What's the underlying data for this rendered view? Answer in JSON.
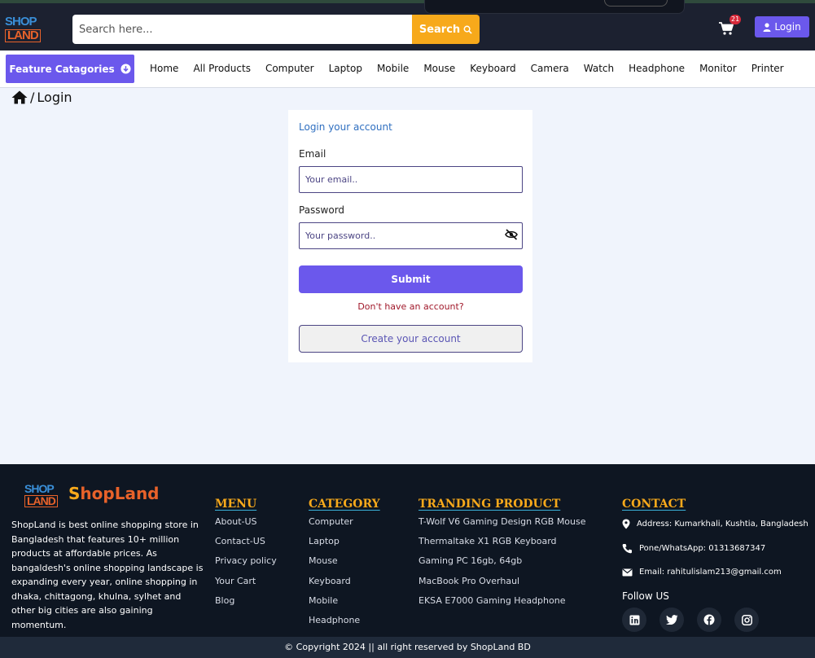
{
  "header": {
    "logo_top": "SHOP",
    "logo_bottom": "LAND",
    "search": {
      "placeholder": "Search here...",
      "button_label": "Search"
    },
    "cart_count": "21",
    "login_label": "Login"
  },
  "nav": {
    "feature_label": "Feature Catagories",
    "links": [
      "Home",
      "All Products",
      "Computer",
      "Laptop",
      "Mobile",
      "Mouse",
      "Keyboard",
      "Camera",
      "Watch",
      "Headphone",
      "Monitor",
      "Printer"
    ]
  },
  "breadcrumb": {
    "current": "Login"
  },
  "login": {
    "title": "Login your account",
    "email_label": "Email",
    "email_placeholder": "Your email..",
    "password_label": "Password",
    "password_placeholder": "Your password..",
    "submit_label": "Submit",
    "no_account_text": "Don't have an account?",
    "create_label": "Create your account"
  },
  "footer": {
    "brand_prefix": "S",
    "brand_rest": "hopLand",
    "description": "ShopLand is best online shopping store in Bangladesh that features 10+ million products at affordable prices. As bangaldesh's online shopping landscape is expanding every year, online shopping in dhaka, chittagong, khulna, sylhet and other big cities are also gaining momentum.",
    "menu": {
      "heading": "MENU",
      "items": [
        "About-US",
        "Contact-US",
        "Privacy policy",
        "Your Cart",
        "Blog"
      ]
    },
    "category": {
      "heading": "CATEGORY",
      "items": [
        "Computer",
        "Laptop",
        "Mouse",
        "Keyboard",
        "Mobile",
        "Headphone"
      ]
    },
    "trending": {
      "heading": "TRANDING PRODUCT",
      "items": [
        "T-Wolf V6 Gaming Design RGB Mouse",
        "Thermaltake X1 RGB Keyboard",
        "Gaming PC 16gb, 64gb",
        "MacBook Pro Overhaul",
        "EKSA E7000 Gaming Headphone"
      ]
    },
    "contact": {
      "heading": "CONTACT",
      "address": "Address: Kumarkhali, Kushtia, Bangladesh",
      "phone": "Pone/WhatsApp: 01313687347",
      "email": "Email: rahitulislam213@gmail.com",
      "follow": "Follow US"
    },
    "copyright": "© Copyright 2024 || all right reserved by ShopLand BD"
  },
  "colors": {
    "accent": "#6b58ec",
    "search": "#f7a91b",
    "header_bg": "#1c2130",
    "footer_bg": "#0e1622",
    "brand_orange": "#e8622a"
  }
}
